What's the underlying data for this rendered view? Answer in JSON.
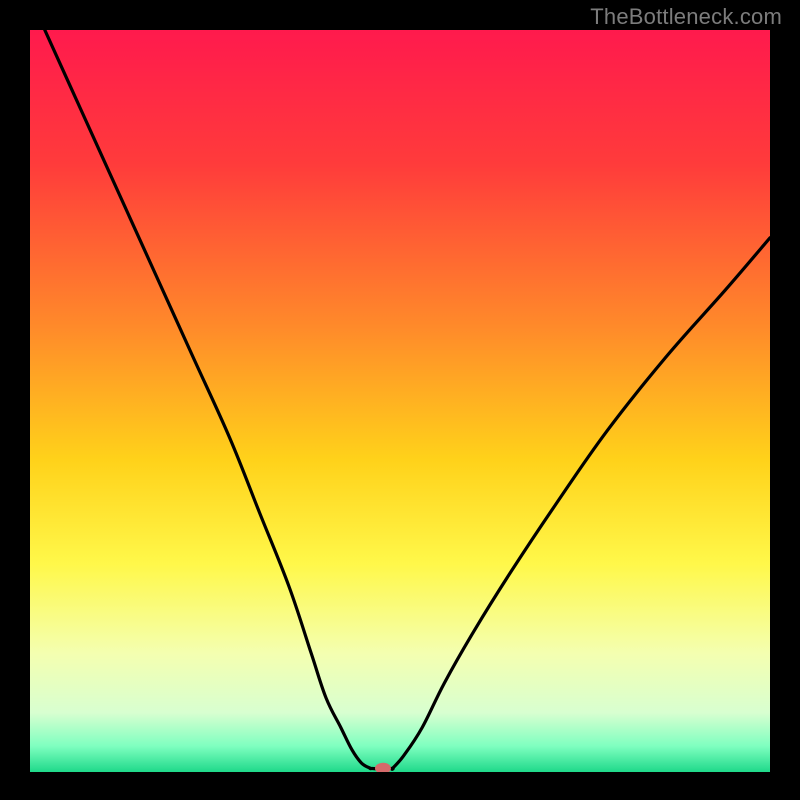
{
  "watermark": "TheBottleneck.com",
  "chart_data": {
    "type": "line",
    "title": "",
    "xlabel": "",
    "ylabel": "",
    "xlim": [
      0,
      100
    ],
    "ylim": [
      0,
      100
    ],
    "gradient_stops": [
      {
        "offset": 0,
        "color": "#ff1a4d"
      },
      {
        "offset": 0.18,
        "color": "#ff3b3b"
      },
      {
        "offset": 0.4,
        "color": "#ff8a2a"
      },
      {
        "offset": 0.58,
        "color": "#ffd21a"
      },
      {
        "offset": 0.72,
        "color": "#fff84a"
      },
      {
        "offset": 0.84,
        "color": "#f4ffb0"
      },
      {
        "offset": 0.92,
        "color": "#d8ffd0"
      },
      {
        "offset": 0.965,
        "color": "#7fffc0"
      },
      {
        "offset": 1.0,
        "color": "#1fd98a"
      }
    ],
    "series": [
      {
        "name": "left-branch",
        "x": [
          2,
          7,
          12,
          17,
          22,
          27,
          31,
          35,
          38,
          40,
          42,
          43.5,
          44.8,
          46.0
        ],
        "values": [
          100,
          89,
          78,
          67,
          56,
          45,
          35,
          25,
          16,
          10,
          6,
          3,
          1.2,
          0.5
        ]
      },
      {
        "name": "flat-bottom",
        "x": [
          46.0,
          47.5,
          49.0
        ],
        "values": [
          0.5,
          0.4,
          0.5
        ]
      },
      {
        "name": "right-branch",
        "x": [
          49.0,
          50.5,
          53,
          56,
          60,
          65,
          71,
          78,
          86,
          94,
          100
        ],
        "values": [
          0.5,
          2.2,
          6,
          12,
          19,
          27,
          36,
          46,
          56,
          65,
          72
        ]
      }
    ],
    "marker": {
      "x": 47.7,
      "y": 0.5,
      "color": "#d46a6a"
    }
  }
}
